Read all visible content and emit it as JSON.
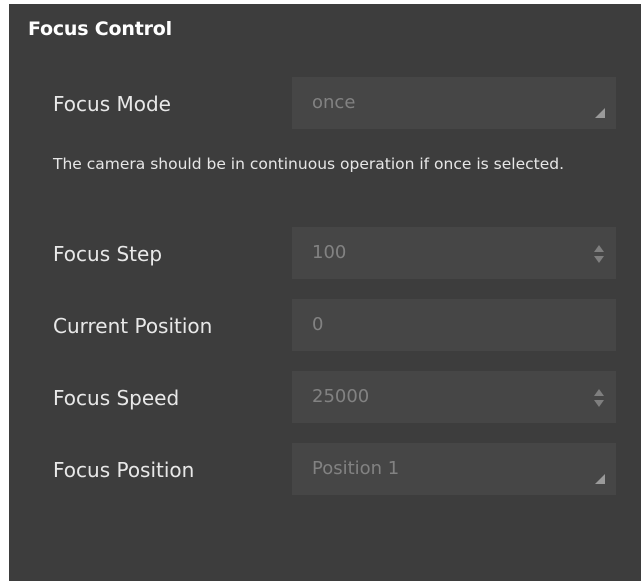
{
  "section": {
    "title": "Focus Control"
  },
  "focus_mode": {
    "label": "Focus Mode",
    "value": "once",
    "note": "The camera should be in continuous operation if once is selected."
  },
  "focus_step": {
    "label": "Focus Step",
    "value": "100"
  },
  "current_position": {
    "label": "Current Position",
    "value": "0"
  },
  "focus_speed": {
    "label": "Focus Speed",
    "value": "25000"
  },
  "focus_position": {
    "label": "Focus Position",
    "value": "Position 1"
  },
  "colors": {
    "panel_bg": "#3d3d3d",
    "field_bg": "#464646",
    "label_text": "#e8e8e8",
    "value_text": "#828282"
  }
}
